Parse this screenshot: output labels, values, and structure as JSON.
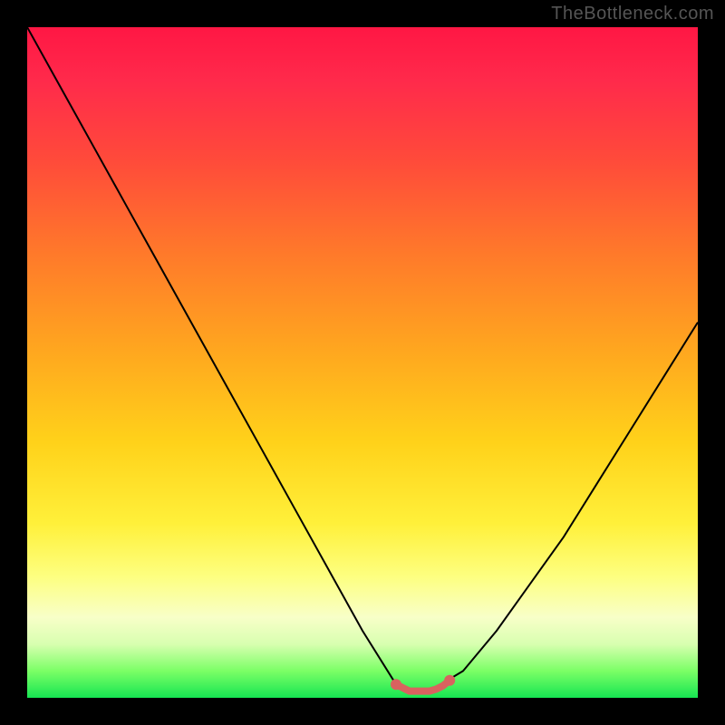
{
  "watermark": "TheBottleneck.com",
  "chart_data": {
    "type": "line",
    "title": "",
    "xlabel": "",
    "ylabel": "",
    "ylim": [
      0,
      100
    ],
    "xlim": [
      0,
      100
    ],
    "series": [
      {
        "name": "bottleneck-curve",
        "x": [
          0,
          5,
          10,
          15,
          20,
          25,
          30,
          35,
          40,
          45,
          50,
          55,
          57,
          60,
          65,
          70,
          75,
          80,
          85,
          90,
          95,
          100
        ],
        "values": [
          100,
          91,
          82,
          73,
          64,
          55,
          46,
          37,
          28,
          19,
          10,
          2,
          1,
          1,
          4,
          10,
          17,
          24,
          32,
          40,
          48,
          56
        ]
      },
      {
        "name": "optimal-range-marker",
        "x": [
          55,
          56,
          57,
          58,
          59,
          60,
          61,
          62,
          63
        ],
        "values": [
          2,
          1.5,
          1,
          1,
          1,
          1,
          1.3,
          1.8,
          2.6
        ]
      }
    ],
    "gradient_stops": [
      {
        "pos": 0,
        "color": "#ff1744"
      },
      {
        "pos": 8,
        "color": "#ff2a4b"
      },
      {
        "pos": 20,
        "color": "#ff4b3a"
      },
      {
        "pos": 34,
        "color": "#ff7a2a"
      },
      {
        "pos": 48,
        "color": "#ffa61f"
      },
      {
        "pos": 62,
        "color": "#ffd21a"
      },
      {
        "pos": 74,
        "color": "#fff03a"
      },
      {
        "pos": 82,
        "color": "#fdff81"
      },
      {
        "pos": 88,
        "color": "#f8ffc8"
      },
      {
        "pos": 92,
        "color": "#d8ffb0"
      },
      {
        "pos": 96,
        "color": "#7bff66"
      },
      {
        "pos": 100,
        "color": "#16e552"
      }
    ],
    "marker_color": "#d9625f",
    "curve_color": "#000000"
  }
}
